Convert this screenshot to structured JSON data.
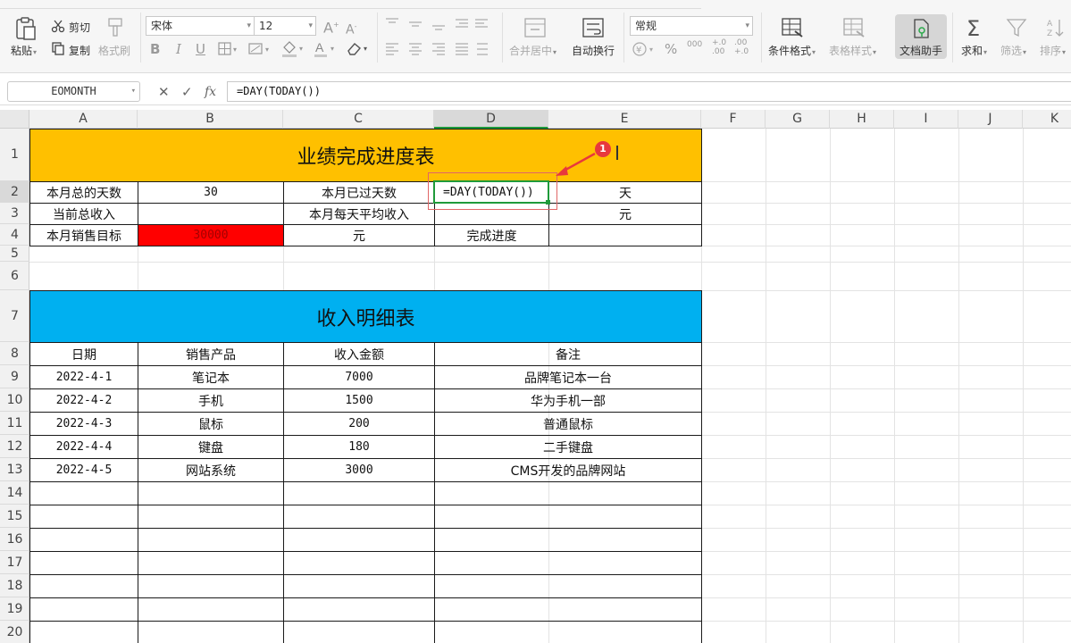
{
  "ribbon": {
    "paste": "粘贴",
    "cut": "剪切",
    "copy": "复制",
    "format_painter": "格式刷",
    "font_name": "宋体",
    "font_size": "12",
    "merge_center": "合并居中",
    "wrap_text": "自动换行",
    "number_format": "常规",
    "conditional_format": "条件格式",
    "table_style": "表格样式",
    "doc_helper": "文档助手",
    "sum": "求和",
    "filter": "筛选",
    "sort": "排序",
    "bold": "B",
    "italic": "I",
    "underline": "U",
    "grow_font": "A",
    "shrink_font": "A",
    "percent": "%",
    "thousands": "000",
    "inc_decimal": "+.0\n.00",
    "dec_decimal": ".00\n+.0"
  },
  "formula_bar": {
    "name_box": "EOMONTH",
    "fx": "fx",
    "formula": "=DAY(TODAY())"
  },
  "columns": [
    "A",
    "B",
    "C",
    "D",
    "E",
    "F",
    "G",
    "H",
    "I",
    "J",
    "K"
  ],
  "rows": [
    "1",
    "2",
    "3",
    "4",
    "5",
    "6",
    "7",
    "8",
    "9",
    "10",
    "11",
    "12",
    "13",
    "14",
    "15",
    "16",
    "17",
    "18",
    "19",
    "20"
  ],
  "sheet": {
    "title1": "业绩完成进度表",
    "r2": {
      "a": "本月总的天数",
      "b": "30",
      "c": "本月已过天数",
      "d": "=DAY(TODAY())",
      "e": "天"
    },
    "r3": {
      "a": "当前总收入",
      "c": "本月每天平均收入",
      "e": "元"
    },
    "r4": {
      "a": "本月销售目标",
      "b": "30000",
      "c": "元",
      "d": "完成进度"
    },
    "title2": "收入明细表",
    "headers": {
      "a": "日期",
      "b": "销售产品",
      "c": "收入金额",
      "d": "备注"
    },
    "data": [
      {
        "date": "2022-4-1",
        "product": "笔记本",
        "amount": "7000",
        "note": "品牌笔记本一台"
      },
      {
        "date": "2022-4-2",
        "product": "手机",
        "amount": "1500",
        "note": "华为手机一部"
      },
      {
        "date": "2022-4-3",
        "product": "鼠标",
        "amount": "200",
        "note": "普通鼠标"
      },
      {
        "date": "2022-4-4",
        "product": "键盘",
        "amount": "180",
        "note": "二手键盘"
      },
      {
        "date": "2022-4-5",
        "product": "网站系统",
        "amount": "3000",
        "note": "CMS开发的品牌网站"
      }
    ]
  },
  "annotation": {
    "badge": "1"
  },
  "colors": {
    "title1_bg": "#ffc000",
    "title2_bg": "#00b0f0",
    "target_bg": "#ff0000",
    "active_border": "#1f9a3a",
    "annotation": "#e8383d"
  }
}
